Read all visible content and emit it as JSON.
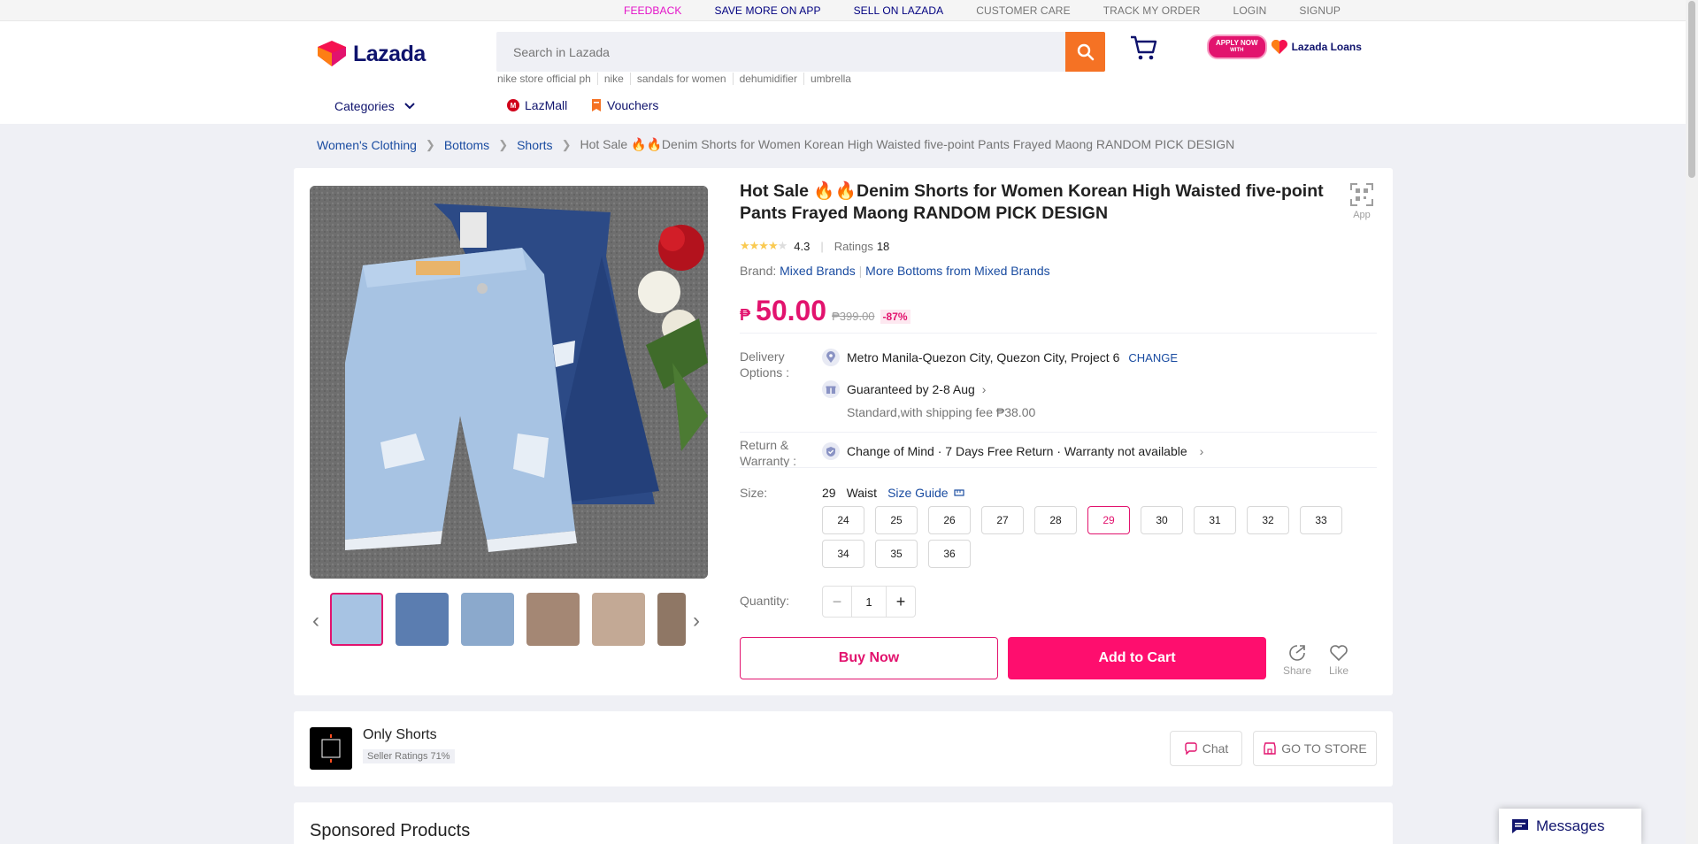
{
  "topbar": {
    "feedback": "FEEDBACK",
    "save_more": "SAVE MORE ON APP",
    "sell": "SELL ON LAZADA",
    "customer_care": "CUSTOMER CARE",
    "track": "TRACK MY ORDER",
    "login": "LOGIN",
    "signup": "SIGNUP"
  },
  "header": {
    "logo": "Lazada",
    "search_placeholder": "Search in Lazada",
    "suggestions": [
      "nike store official ph",
      "nike",
      "sandals for women",
      "dehumidifier",
      "umbrella"
    ],
    "apply_now": "APPLY NOW",
    "apply_with": "WITH",
    "loans": "Lazada Loans",
    "categories": "Categories",
    "lazmall": "LazMall",
    "vouchers": "Vouchers"
  },
  "breadcrumb": [
    "Women's Clothing",
    "Bottoms",
    "Shorts"
  ],
  "breadcrumb_current": "Hot Sale 🔥🔥Denim Shorts for Women Korean High Waisted five-point Pants Frayed Maong RANDOM PICK DESIGN",
  "product": {
    "title": "Hot Sale 🔥🔥Denim Shorts for Women Korean High Waisted five-point Pants Frayed Maong RANDOM PICK DESIGN",
    "app_label": "App",
    "rating_value": "4.3",
    "rating_stars": 4.3,
    "ratings_label": "Ratings",
    "ratings_count": "18",
    "brand_label": "Brand:",
    "brand": "Mixed Brands",
    "more_brand": "More Bottoms from Mixed Brands",
    "currency": "₱",
    "price": "50.00",
    "old_price": "₱399.00",
    "discount": "-87%"
  },
  "delivery": {
    "label": "Delivery Options :",
    "location": "Metro Manila-Quezon City, Quezon City, Project 6",
    "change": "CHANGE",
    "guaranteed": "Guaranteed by 2-8 Aug",
    "shipping": "Standard,with shipping fee ₱38.00"
  },
  "return": {
    "label": "Return & Warranty :",
    "text": "Change of Mind · 7 Days Free Return · Warranty not available"
  },
  "size": {
    "label": "Size:",
    "selected": "29",
    "unit": "Waist",
    "guide": "Size Guide",
    "options": [
      "24",
      "25",
      "26",
      "27",
      "28",
      "29",
      "30",
      "31",
      "32",
      "33",
      "34",
      "35",
      "36"
    ]
  },
  "quantity": {
    "label": "Quantity:",
    "minus": "−",
    "value": "1",
    "plus": "+"
  },
  "buttons": {
    "buy_now": "Buy Now",
    "add_to_cart": "Add to Cart",
    "share": "Share",
    "like": "Like"
  },
  "seller": {
    "name": "Only Shorts",
    "rating": "Seller Ratings 71%",
    "chat": "Chat",
    "store": "GO TO STORE"
  },
  "sponsored_title": "Sponsored Products",
  "messages_label": "Messages",
  "colors": {
    "brand_pink": "#e2136e",
    "orange": "#f57224",
    "navy": "#0f136d",
    "link_blue": "#1a4ca1"
  }
}
